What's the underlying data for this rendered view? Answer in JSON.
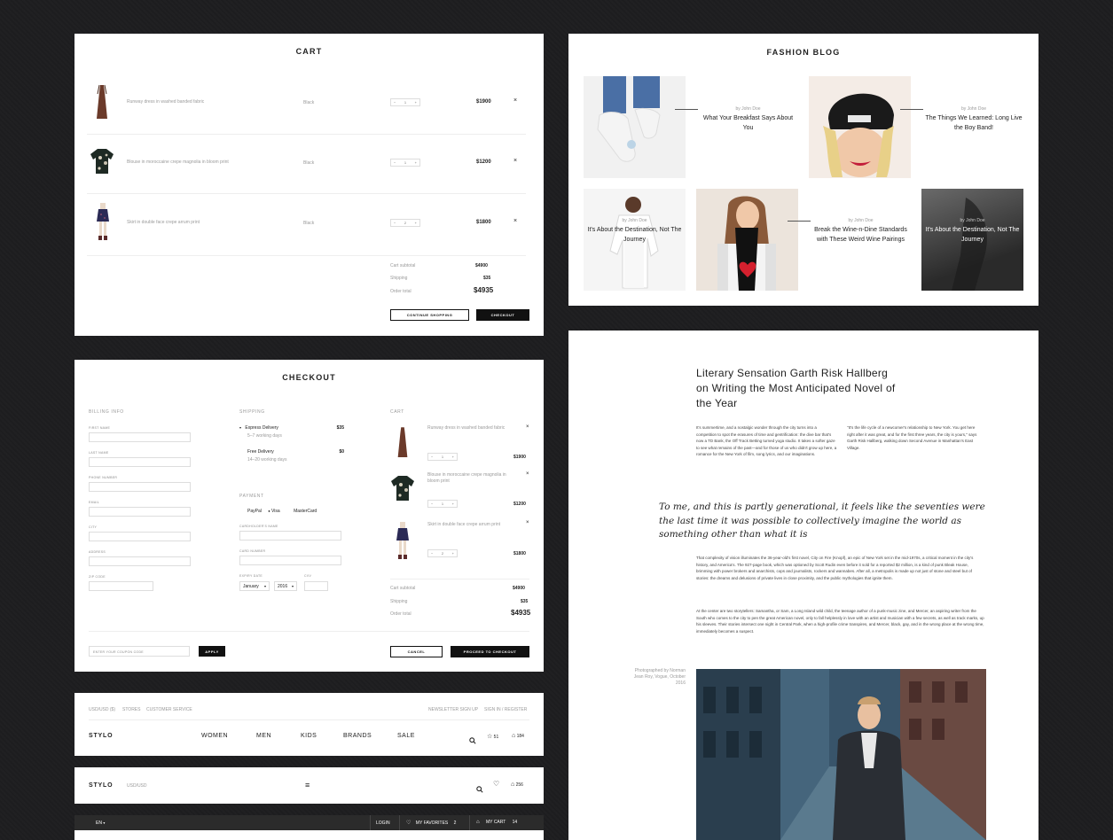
{
  "cart": {
    "title": "CART",
    "items": [
      {
        "name": "Runway dress in washed banded fabric",
        "color": "Black",
        "qty": "1",
        "price": "$1900"
      },
      {
        "name": "Blouse in moroccaine crepe magnolia in bloom print",
        "color": "Black",
        "qty": "1",
        "price": "$1200"
      },
      {
        "name": "Skirt in double face crepe arrum print",
        "color": "Black",
        "qty": "2",
        "price": "$1800"
      }
    ],
    "remove_symbol": "×",
    "minus": "−",
    "plus": "+",
    "subtotal_label": "Cart subtotal",
    "subtotal": "$4900",
    "shipping_label": "Shipping",
    "shipping": "$35",
    "total_label": "Order total",
    "total": "$4935",
    "continue_label": "CONTINUE SHOPPING",
    "checkout_label": "CHECKOUT"
  },
  "checkout": {
    "title": "CHECKOUT",
    "billing_heading": "BILLING INFO",
    "billing_fields": [
      "FIRST NAME",
      "LAST NAME",
      "PHONE NUMBER",
      "EMAIL",
      "CITY",
      "ADDRESS",
      "ZIP CODE"
    ],
    "shipping_heading": "SHIPPING",
    "shipping_options": [
      {
        "name": "Express Delivery",
        "time": "5–7 working days",
        "price": "$35"
      },
      {
        "name": "Free Delivery",
        "time": "14–20 working days",
        "price": "$0"
      }
    ],
    "payment_heading": "PAYMENT",
    "payment_options": [
      "PayPal",
      "Visa",
      "MasterCard"
    ],
    "card_holder_label": "CARDHOLDER'S NAME",
    "card_number_label": "CARD NUMBER",
    "expiry_label": "EXPIRY DATE",
    "cvv_label": "CVV",
    "month": "January",
    "year": "2016",
    "cart_heading": "CART",
    "cart_items": [
      {
        "name": "Runway dress in washed banded fabric",
        "qty": "1",
        "price": "$1900"
      },
      {
        "name": "Blouse in moroccaine crepe magnolia in bloom print",
        "qty": "1",
        "price": "$1200"
      },
      {
        "name": "Skirt in double face crepe arrum print",
        "qty": "2",
        "price": "$1800"
      }
    ],
    "subtotal_label": "Cart subtotal",
    "subtotal": "$4900",
    "shipping_label": "Shipping",
    "shipping": "$35",
    "total_label": "Order total",
    "total": "$4935",
    "coupon_placeholder": "ENTER YOUR COUPON CODE",
    "apply_label": "APPLY",
    "cancel_label": "CANCEL",
    "proceed_label": "PROCEED TO CHECKOUT"
  },
  "header1": {
    "currency": "USD/USD ($)",
    "stores": "STORES",
    "customer_service": "CUSTOMER SERVICE",
    "newsletter": "NEWSLETTER SIGN UP",
    "signin": "SIGN IN / REGISTER",
    "logo": "STYLO",
    "nav": [
      "WOMEN",
      "MEN",
      "KIDS",
      "BRANDS",
      "SALE"
    ],
    "fav_count": "51",
    "cart_count": "184"
  },
  "header2": {
    "logo": "STYLO",
    "currency": "USD/USD",
    "menu_symbol": "≡",
    "cart_count": "256"
  },
  "header3": {
    "lang": "EN",
    "login": "LOGIN",
    "favorites": "MY FAVORITES",
    "fav_count": "2",
    "cart": "MY CART",
    "cart_count": "14"
  },
  "blog": {
    "title": "FASHION BLOG",
    "posts": [
      {
        "author": "by John Doe",
        "title": "What Your Breakfast Says About You"
      },
      {
        "author": "by John Doe",
        "title": "The Things We Learned: Long Live the Boy Band!"
      },
      {
        "author": "by John Doe",
        "title": "It's About the Destination, Not The Journey"
      },
      {
        "author": "by John Doe",
        "title": "Break the Wine-n-Dine Standards with These Weird Wine Pairings"
      },
      {
        "author": "by John Doe",
        "title": "It's About the Destination, Not The Journey"
      }
    ]
  },
  "article": {
    "headline": "Literary Sensation Garth Risk Hallberg on Writing the Most Anticipated Novel of the Year",
    "col1": "It's summertime, and a nostalgic wonder through the city turns into a competition to spot the erasures of time and gentrification: the dive bar that's now a TD Bank, the Off Track Betting turned yoga studio. It takes a softer gaze to see what remains of the past—and for those of us who didn't grow up here, a romance for the New York of film, song lyrics, and our imaginations.",
    "col2": "\"It's the life cycle of a newcomer's relationship to New York. You get here right after it was great, and for the first three years, the city is yours,\" says Garth Risk Hallberg, walking down Second Avenue in Manhattan's East Village.",
    "quote": "To me, and this is partly generational, it feels like the seventies were the last time it was possible to collectively imagine the world as something other than what it is",
    "para1": "That complexity of vision illuminates the 36-year-old's first novel, City on Fire (Knopf), an epic of New York set in the mid-1970s, a critical moment in the city's history, and America's. The 927-page book, which was optioned by Scott Rudin even before it sold for a reported $2 million, is a kind of punk Bleak House, brimming with power brokers and anarchists, cops and journalists, rockers and wannabes. After all, a metropolis is made up not just of stone and steel but of stories: the dreams and delusions of private lives in close proximity, and the public mythologies that ignite them.",
    "para2": "At the center are two storytellers: Samantha, or Sam, a Long Island wild child, the teenage author of a punk-music zine, and Mercer, an aspiring writer from the South who comes to the city to pen the great American novel, only to fall helplessly in love with an artist and musician with a few secrets, as well as track marks, up his sleeves. Their stories intersect one night in Central Park, when a high-profile crime transpires, and Mercer, black, gay, and in the wrong place at the wrong time, immediately becomes a suspect.",
    "credit": "Photographed by Norman Jean Roy, Vogue, October 2016"
  },
  "colors": {
    "background": "#1d1d1f",
    "panel": "#ffffff",
    "ink": "#111111",
    "muted": "#9a9a9a"
  }
}
